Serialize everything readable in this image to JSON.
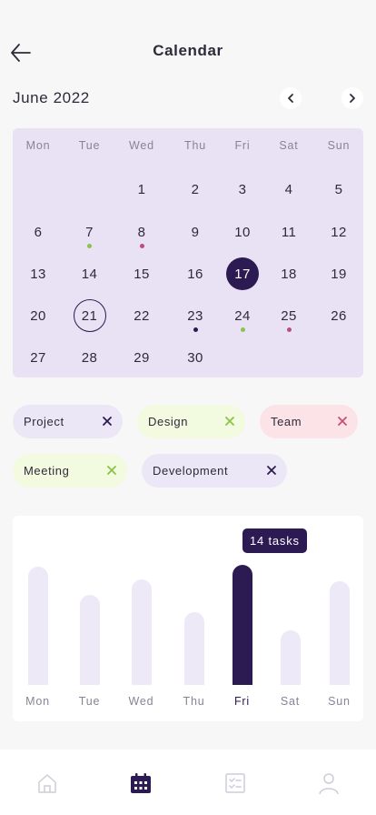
{
  "header": {
    "title": "Calendar"
  },
  "calendar": {
    "month_label": "June 2022",
    "weekdays": [
      "Mon",
      "Tue",
      "Wed",
      "Thu",
      "Fri",
      "Sat",
      "Sun"
    ],
    "weeks": [
      [
        "",
        "",
        "1",
        "2",
        "3",
        "4",
        "5"
      ],
      [
        "6",
        "7",
        "8",
        "9",
        "10",
        "11",
        "12"
      ],
      [
        "13",
        "14",
        "15",
        "16",
        "17",
        "18",
        "19"
      ],
      [
        "20",
        "21",
        "22",
        "23",
        "24",
        "25",
        "26"
      ],
      [
        "27",
        "28",
        "29",
        "30",
        "",
        "",
        ""
      ]
    ],
    "selected_day": "17",
    "today_day": "21",
    "event_dots": [
      {
        "day": "7",
        "color": "#8bc34a"
      },
      {
        "day": "8",
        "color": "#b9507a"
      },
      {
        "day": "23",
        "color": "#2c1a53"
      },
      {
        "day": "24",
        "color": "#8bc34a"
      },
      {
        "day": "25",
        "color": "#b9507a"
      }
    ]
  },
  "filters": [
    {
      "label": "Project",
      "bg": "#ebe7f7",
      "x_color": "#2c1a53",
      "icon": "close-icon"
    },
    {
      "label": "Design",
      "bg": "#f2fbdf",
      "x_color": "#8bc34a",
      "icon": "close-icon"
    },
    {
      "label": "Team",
      "bg": "#fbe3e7",
      "x_color": "#c9506e",
      "icon": "close-icon"
    },
    {
      "label": "Meeting",
      "bg": "#f2fbdf",
      "x_color": "#8bc34a",
      "icon": "close-icon"
    },
    {
      "label": "Development",
      "bg": "#ebe7f7",
      "x_color": "#2c1a53",
      "icon": "close-icon"
    }
  ],
  "weekly_tasks": {
    "tooltip": "14 tasks",
    "active_day": "Fri",
    "days": [
      "Mon",
      "Tue",
      "Wed",
      "Thu",
      "Fri",
      "Sat",
      "Sun"
    ],
    "values": [
      0.985,
      0.75,
      0.88,
      0.605,
      1.0,
      0.455,
      0.865
    ]
  },
  "bottom_nav": [
    {
      "icon": "home-icon",
      "active": false
    },
    {
      "icon": "calendar-icon",
      "active": true
    },
    {
      "icon": "tasks-icon",
      "active": false
    },
    {
      "icon": "profile-icon",
      "active": false
    }
  ],
  "colors": {
    "accent": "#2c1a53",
    "calendar_bg": "#e9e1f4",
    "bar_inactive": "#ede9f7"
  }
}
